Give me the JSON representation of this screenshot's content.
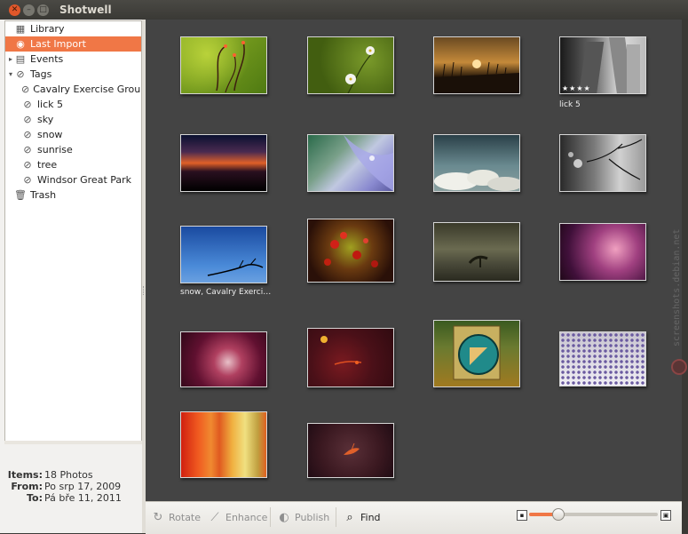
{
  "window": {
    "title": "Shotwell"
  },
  "sidebar": {
    "library": "Library",
    "last_import": "Last Import",
    "events": "Events",
    "tags": "Tags",
    "tag_items": [
      "Cavalry Exercise Ground",
      "lick 5",
      "sky",
      "snow",
      "sunrise",
      "tree",
      "Windsor Great Park"
    ],
    "trash": "Trash"
  },
  "metadata": {
    "items_label": "Items:",
    "items_value": "18 Photos",
    "from_label": "From:",
    "from_value": "Po srp 17, 2009",
    "to_label": "To:",
    "to_value": "Pá bře 11, 2011"
  },
  "photos": [
    {
      "caption": ""
    },
    {
      "caption": ""
    },
    {
      "caption": ""
    },
    {
      "caption": "lick 5",
      "stars": "★★★★"
    },
    {
      "caption": ""
    },
    {
      "caption": ""
    },
    {
      "caption": ""
    },
    {
      "caption": ""
    },
    {
      "caption": "snow, Cavalry Exerci…"
    },
    {
      "caption": ""
    },
    {
      "caption": ""
    },
    {
      "caption": ""
    },
    {
      "caption": ""
    },
    {
      "caption": ""
    },
    {
      "caption": ""
    },
    {
      "caption": ""
    },
    {
      "caption": ""
    },
    {
      "caption": ""
    }
  ],
  "toolbar": {
    "rotate": "Rotate",
    "enhance": "Enhance",
    "publish": "Publish",
    "find": "Find",
    "zoom_level": 0.22
  },
  "watermark": "screenshots.debian.net",
  "colors": {
    "accent": "#f07746",
    "grid_bg": "#444444"
  }
}
